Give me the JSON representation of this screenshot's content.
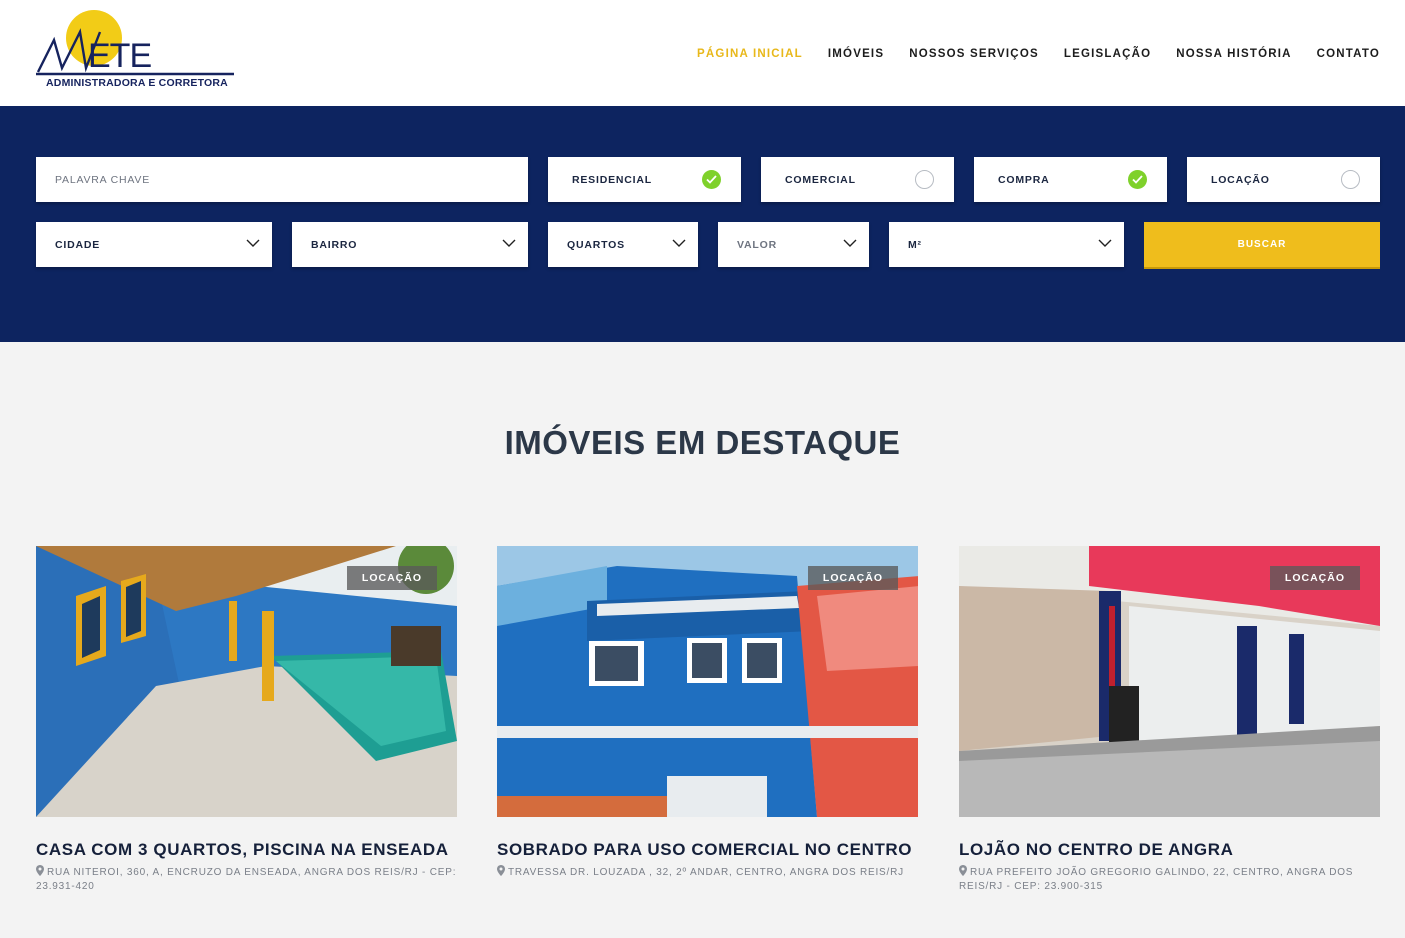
{
  "header": {
    "logo_text": "MAETE",
    "logo_tagline": "ADMINISTRADORA E CORRETORA",
    "nav": [
      {
        "label": "PÁGINA INICIAL",
        "active": true
      },
      {
        "label": "IMÓVEIS"
      },
      {
        "label": "NOSSOS SERVIÇOS"
      },
      {
        "label": "LEGISLAÇÃO"
      },
      {
        "label": "NOSSA HISTÓRIA"
      },
      {
        "label": "CONTATO"
      }
    ]
  },
  "search": {
    "keyword_placeholder": "PALAVRA CHAVE",
    "type_options": [
      {
        "label": "RESIDENCIAL",
        "checked": true
      },
      {
        "label": "COMERCIAL",
        "checked": false
      }
    ],
    "purpose_options": [
      {
        "label": "COMPRA",
        "checked": true
      },
      {
        "label": "LOCAÇÃO",
        "checked": false
      }
    ],
    "selects": {
      "cidade": "CIDADE",
      "bairro": "BAIRRO",
      "quartos": "QUARTOS",
      "valor": "VALOR",
      "area": "M²"
    },
    "button_label": "BUSCAR"
  },
  "featured": {
    "title": "IMÓVEIS EM DESTAQUE",
    "cards": [
      {
        "badge": "LOCAÇÃO",
        "title": "CASA COM 3 QUARTOS, PISCINA NA ENSEADA",
        "address": "RUA NITEROI, 360, A, ENCRUZO DA ENSEADA, ANGRA DOS REIS/RJ - CEP: 23.931-420",
        "image_icon": "house-with-pool-photo"
      },
      {
        "badge": "LOCAÇÃO",
        "title": "SOBRADO PARA USO COMERCIAL NO CENTRO",
        "address": "TRAVESSA DR. LOUZADA , 32, 2º ANDAR, CENTRO, ANGRA DOS REIS/RJ",
        "image_icon": "blue-townhouse-photo"
      },
      {
        "badge": "LOCAÇÃO",
        "title": "LOJÃO NO CENTRO DE ANGRA",
        "address": "RUA PREFEITO JOÃO GREGORIO GALINDO, 22, CENTRO, ANGRA DOS REIS/RJ - CEP: 23.900-315",
        "image_icon": "storefront-photo"
      }
    ]
  },
  "colors": {
    "brand_navy": "#0d2460",
    "accent_yellow": "#efbd1c",
    "check_green": "#7fd12b"
  }
}
